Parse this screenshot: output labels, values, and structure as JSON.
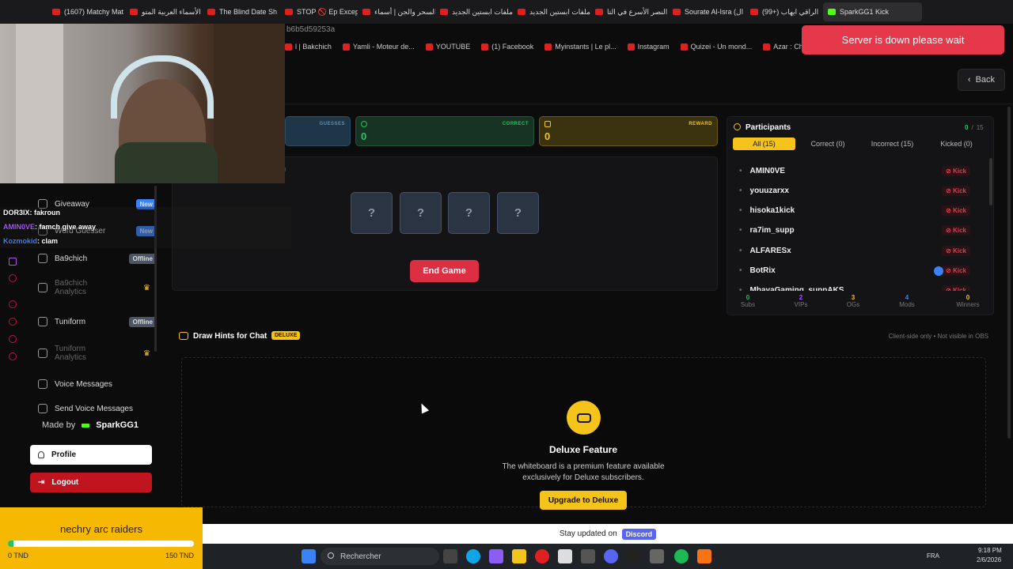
{
  "browser": {
    "tabs": [
      {
        "label": "(1607) Matchy Mat"
      },
      {
        "label": "الأسماء العربية المتو"
      },
      {
        "label": "The Blind Date Sh"
      },
      {
        "label": "STOP 🚫 Ep Excep"
      },
      {
        "label": "السحر والجن | أسماء"
      },
      {
        "label": "ملفات ابستين الجديد"
      },
      {
        "label": "ملفات ابستين الجديد"
      },
      {
        "label": "النصر الأسرع في التا"
      },
      {
        "label": "Sourate Al-Isra (ال"
      },
      {
        "label": "(99+) الراقي ايهاب"
      },
      {
        "label": "SparkGG1 Kick"
      }
    ],
    "url_fragment": "b6b5d59253a",
    "bookmarks": [
      "l | Bakchich",
      "Yamli - Moteur de...",
      "YOUTUBE",
      "(1) Facebook",
      "Myinstants | Le pl...",
      "Instagram",
      "Quizei - Un mond...",
      "Azar : Chat Vidéo..."
    ]
  },
  "toast": "Server is down please wait",
  "back_label": "Back",
  "stats": {
    "guesses_label": "GUESSES",
    "correct_label": "CORRECT",
    "correct_value": "0",
    "reward_label": "REWARD",
    "reward_value": "0"
  },
  "game": {
    "hidden_letters": [
      "?",
      "?",
      "?",
      "?"
    ],
    "end_game_label": "End Game",
    "partial_text": ")"
  },
  "participants": {
    "title": "Participants",
    "count_current": "0",
    "count_sep": "/",
    "count_max": "15",
    "tabs": [
      "All (15)",
      "Correct (0)",
      "Incorrect (15)",
      "Kicked (0)"
    ],
    "kick_label": "Kick",
    "rows": [
      "AMIN0VE",
      "youuzarxx",
      "hisoka1kick",
      "ra7im_supp",
      "ALFARESx",
      "BotRix",
      "MhayaGaming_suppAKS"
    ],
    "stats": [
      {
        "value": "0",
        "label": "Subs",
        "color": "#22c55e"
      },
      {
        "value": "2",
        "label": "VIPs",
        "color": "#a855f7"
      },
      {
        "value": "3",
        "label": "OGs",
        "color": "#f5c41b"
      },
      {
        "value": "4",
        "label": "Mods",
        "color": "#3b82f6"
      },
      {
        "value": "0",
        "label": "Winners",
        "color": "#f5c41b"
      }
    ]
  },
  "sidebar": {
    "items": [
      {
        "label": "Giveaway",
        "badge": "New",
        "badge_color": "#3b82f6"
      },
      {
        "label": "Word Guesser",
        "badge": "New",
        "badge_color": "#3b82f6"
      },
      {
        "label": "Ba9chich",
        "badge": "Offline",
        "badge_color": "#4b5563"
      },
      {
        "label": "Ba9chich Analytics",
        "badge": "",
        "badge_color": ""
      },
      {
        "label": "Tuniform",
        "badge": "Offline",
        "badge_color": "#4b5563"
      },
      {
        "label": "Tuniform Analytics",
        "badge": "",
        "badge_color": ""
      },
      {
        "label": "Voice Messages",
        "badge": "",
        "badge_color": ""
      },
      {
        "label": "Send Voice Messages",
        "badge": "",
        "badge_color": ""
      }
    ],
    "made_by_label": "Made by",
    "made_by_name": "SparkGG1",
    "profile_label": "Profile",
    "logout_label": "Logout"
  },
  "chat": [
    {
      "user": "DOR3IX",
      "message": ": fakroun",
      "user_color": "#ffffff"
    },
    {
      "user": "AMIN0VE",
      "message": ": famch give away",
      "user_color": "#a855f7"
    },
    {
      "user": "Kozmokid",
      "message": ": clam",
      "user_color": "#3b82f6"
    }
  ],
  "hints": {
    "title": "Draw Hints for Chat",
    "badge": "DELUXE",
    "note": "Client-side only • Not visible in OBS",
    "feature_title": "Deluxe Feature",
    "feature_desc_1": "The whiteboard is a premium feature available",
    "feature_desc_2": "exclusively for Deluxe subscribers.",
    "upgrade_label": "Upgrade to Deluxe"
  },
  "bottom": {
    "stay_text": "Stay updated on",
    "discord_label": "Discord"
  },
  "goal": {
    "title": "nechry arc raiders",
    "min_label": "0 TND",
    "max_label": "150 TND",
    "progress": 0.03
  },
  "taskbar": {
    "search_placeholder": "Rechercher",
    "lang": "FRA",
    "time": "9:18 PM",
    "date": "2/6/2026"
  },
  "colors": {
    "accent": "#f5c41b",
    "danger": "#e5384a",
    "kick_green": "#53fc18"
  }
}
